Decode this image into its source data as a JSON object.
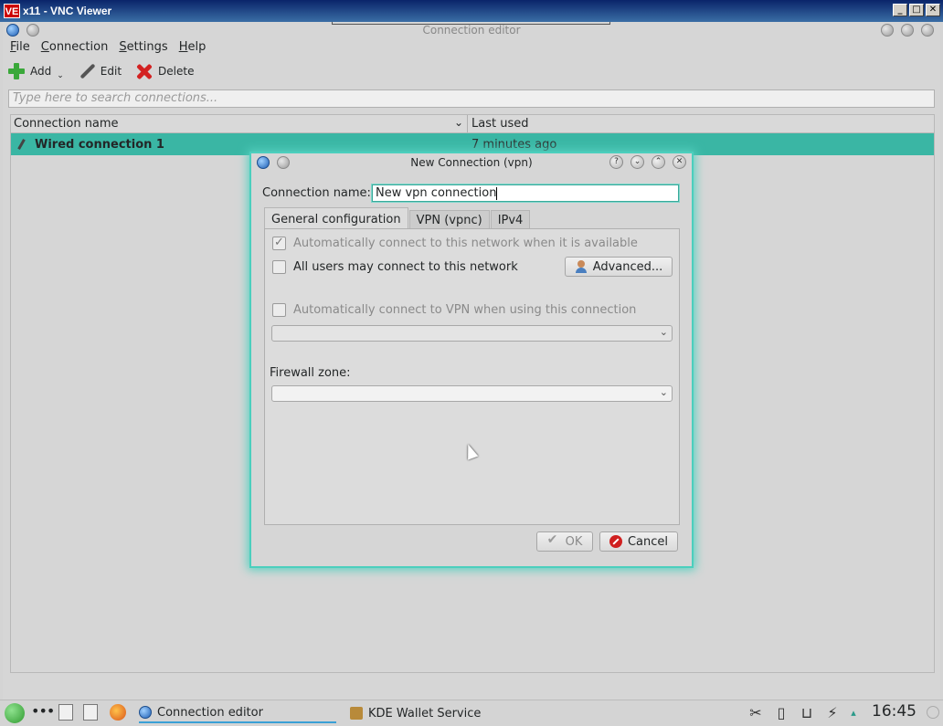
{
  "vnc": {
    "logo": "VE",
    "title": "x11 - VNC Viewer",
    "buttons": [
      "_",
      "□",
      "✕"
    ]
  },
  "app": {
    "title": "Connection editor",
    "menu": [
      {
        "label": "File",
        "mnemonic": "F",
        "rest": "ile"
      },
      {
        "label": "Connection",
        "mnemonic": "C",
        "rest": "onnection"
      },
      {
        "label": "Settings",
        "mnemonic": "S",
        "rest": "ettings"
      },
      {
        "label": "Help",
        "mnemonic": "H",
        "rest": "elp"
      }
    ],
    "toolbar": {
      "add_label": "Add",
      "add_chevron": "⌄",
      "edit_label": "Edit",
      "delete_label": "Delete"
    },
    "search": {
      "placeholder": "Type here to search connections..."
    },
    "list": {
      "col_name": "Connection name",
      "col_last_used": "Last used",
      "sort_indicator": "⌄",
      "rows": [
        {
          "name": "Wired connection 1",
          "last_used": "7 minutes ago"
        }
      ]
    }
  },
  "dialog": {
    "title": "New Connection (vpn)",
    "title_buttons": [
      "?",
      "⌄",
      "⌃",
      "✕"
    ],
    "connection_name_label": "Connection name:",
    "connection_name_value": "New vpn connection",
    "tabs": [
      {
        "label": "General configuration",
        "active": true
      },
      {
        "label": "VPN (vpnc)",
        "active": false
      },
      {
        "label": "IPv4",
        "active": false
      }
    ],
    "auto_connect": {
      "label": "Automatically connect to this network when it is available",
      "checked": true,
      "enabled": false
    },
    "all_users": {
      "label": "All users may connect to this network",
      "checked": false,
      "enabled": true
    },
    "advanced_button": "Advanced...",
    "auto_vpn": {
      "label": "Automatically connect to VPN when using this connection",
      "checked": false,
      "enabled": false
    },
    "vpn_select": {
      "value": ""
    },
    "firewall_label": "Firewall zone:",
    "firewall_select": {
      "value": ""
    },
    "combo_arrow": "⌄",
    "ok_button": "OK",
    "cancel_button": "Cancel"
  },
  "taskbar": {
    "dots": "•••",
    "tasks": [
      {
        "label": "Connection editor",
        "active": true
      },
      {
        "label": "KDE Wallet Service",
        "active": false
      }
    ],
    "tray_icons": [
      "scissors-icon",
      "clipboard-icon",
      "network-icon",
      "plug-icon",
      "arrow-up-icon"
    ],
    "tray_glyphs": [
      "✂",
      "▯",
      "⊔",
      "⚡",
      "▴"
    ],
    "clock": "16:45"
  },
  "colors": {
    "selection": "#3ab6a4",
    "dialog_glow": "#4bcfbd",
    "titlebar": "#0a246a"
  }
}
